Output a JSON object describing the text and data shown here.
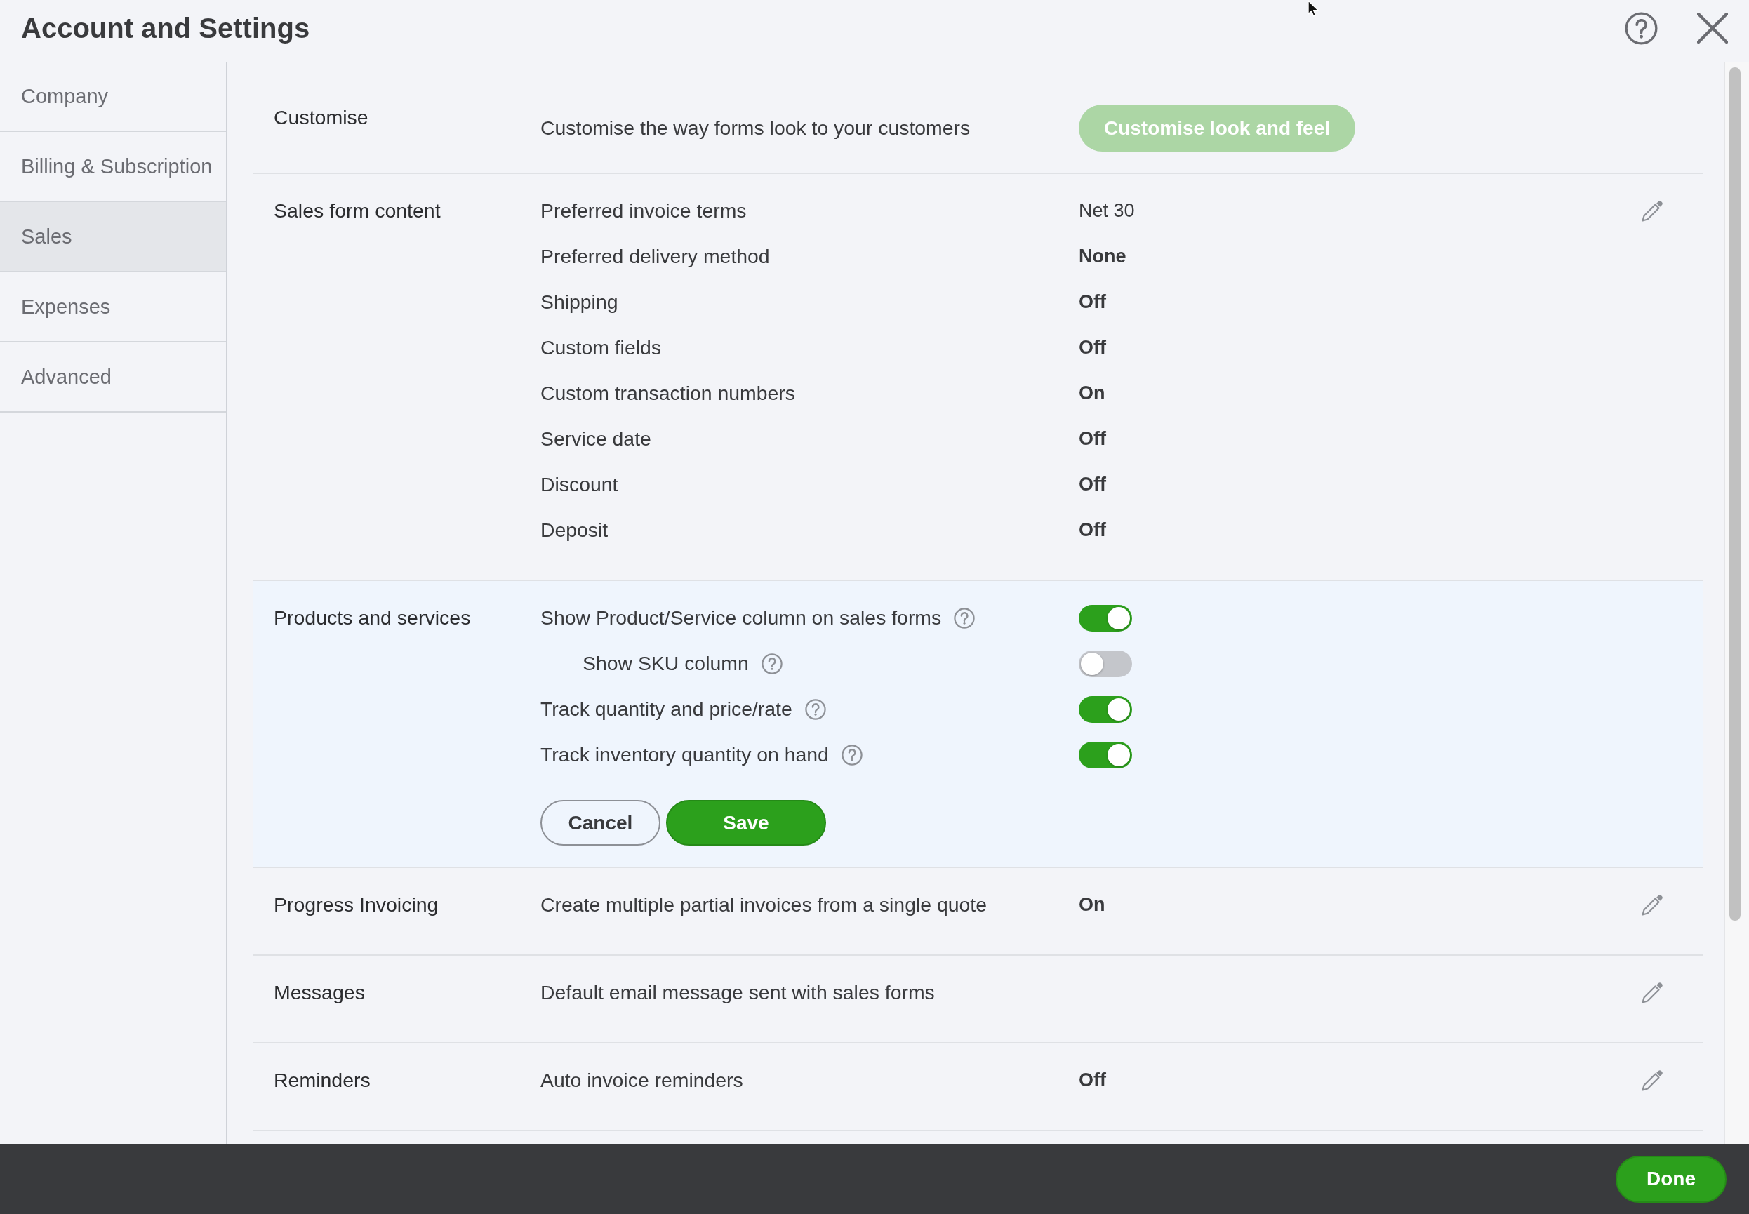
{
  "window": {
    "title": "Account and Settings"
  },
  "sidebar": {
    "items": [
      {
        "label": "Company",
        "selected": false
      },
      {
        "label": "Billing & Subscription",
        "selected": false
      },
      {
        "label": "Sales",
        "selected": true
      },
      {
        "label": "Expenses",
        "selected": false
      },
      {
        "label": "Advanced",
        "selected": false
      }
    ]
  },
  "sections": [
    {
      "kind": "action",
      "title": "Customise",
      "editable": false,
      "description": "Customise the way forms look to your customers",
      "button": {
        "label": "Customise look and feel",
        "disabled": true
      }
    },
    {
      "kind": "list",
      "title": "Sales form content",
      "editable": true,
      "rows": [
        {
          "label": "Preferred invoice terms",
          "value": "Net 30",
          "bold": false
        },
        {
          "label": "Preferred delivery method",
          "value": "None",
          "bold": true
        },
        {
          "label": "Shipping",
          "value": "Off",
          "bold": true
        },
        {
          "label": "Custom fields",
          "value": "Off",
          "bold": true
        },
        {
          "label": "Custom transaction numbers",
          "value": "On",
          "bold": true
        },
        {
          "label": "Service date",
          "value": "Off",
          "bold": true
        },
        {
          "label": "Discount",
          "value": "Off",
          "bold": true
        },
        {
          "label": "Deposit",
          "value": "Off",
          "bold": true
        }
      ]
    },
    {
      "kind": "toggles",
      "title": "Products and services",
      "editable": false,
      "rows": [
        {
          "label": "Show Product/Service column on sales forms",
          "on": true,
          "children": [
            {
              "label": "Show SKU column",
              "on": false
            }
          ]
        },
        {
          "label": "Track quantity and price/rate",
          "on": true
        },
        {
          "label": "Track inventory quantity on hand",
          "on": true
        }
      ],
      "buttons": [
        {
          "label": "Cancel",
          "kind": "secondary"
        },
        {
          "label": "Save",
          "kind": "primary"
        }
      ]
    },
    {
      "kind": "list",
      "title": "Progress Invoicing",
      "editable": true,
      "rows": [
        {
          "label": "Create multiple partial invoices from a single quote",
          "value": "On",
          "bold": true
        }
      ]
    },
    {
      "kind": "list",
      "title": "Messages",
      "editable": true,
      "rows": [
        {
          "label": "Default email message sent with sales forms"
        }
      ]
    },
    {
      "kind": "list",
      "title": "Reminders",
      "editable": true,
      "rows": [
        {
          "label": "Auto invoice reminders",
          "value": "Off",
          "bold": true
        }
      ]
    }
  ],
  "footer": {
    "button": {
      "label": "Done"
    }
  }
}
